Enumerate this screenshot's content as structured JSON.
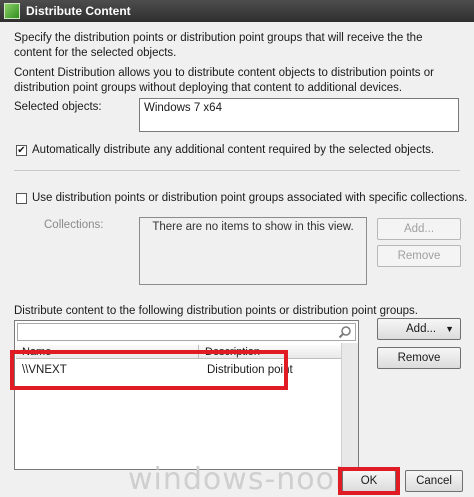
{
  "window": {
    "title": "Distribute Content"
  },
  "intro": {
    "line1": "Specify the distribution points or distribution point groups that will receive the the content for the selected objects.",
    "line2": "Content Distribution allows you to distribute content objects to distribution points or distribution point groups without deploying that content to additional devices."
  },
  "selected_objects": {
    "label": "Selected objects:",
    "value": "Windows 7 x64"
  },
  "auto_distribute": {
    "label": "Automatically distribute any additional content required by the selected objects.",
    "checked": true,
    "check_mark": "✔"
  },
  "collections_option": {
    "label": "Use distribution points or distribution point groups associated with specific collections.",
    "checked": false
  },
  "collections": {
    "label": "Collections:",
    "empty_text": "There are no items to show in this view.",
    "add_label": "Add...",
    "remove_label": "Remove"
  },
  "distribute_section": {
    "label": "Distribute content to the following distribution points or distribution point groups.",
    "search_placeholder": "",
    "columns": [
      "Name",
      "Description"
    ],
    "rows": [
      {
        "name": "\\\\VNEXT",
        "description": "Distribution point"
      }
    ],
    "add_label": "Add...",
    "add_arrow": "▼",
    "remove_label": "Remove"
  },
  "footer": {
    "ok_label": "OK",
    "cancel_label": "Cancel"
  },
  "watermark": "windows-noob.com",
  "colors": {
    "highlight": "#e01b24",
    "titlebar": "#3a3a3a"
  },
  "icons": {
    "search": "magnifier-icon",
    "app": "app-icon"
  }
}
